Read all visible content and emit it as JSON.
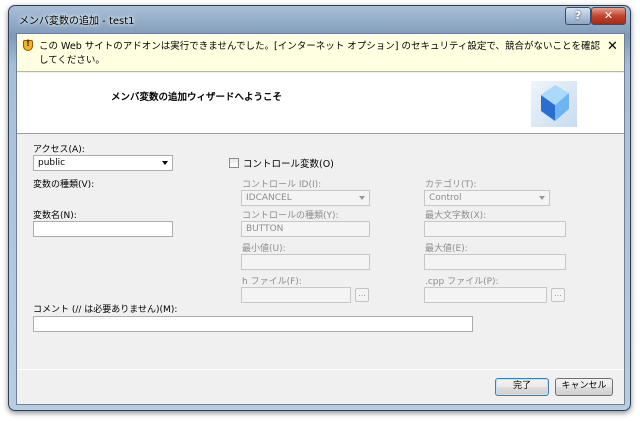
{
  "window": {
    "title": "メンバ変数の追加 - test1",
    "help_label": "?",
    "close_label": "✕"
  },
  "infobar": {
    "message": "この Web サイトのアドオンは実行できませんでした。[インターネット オプション] のセキュリティ設定で、競合がないことを確認してください。",
    "close_label": "✕"
  },
  "header": {
    "welcome": "メンバ変数の追加ウィザードへようこそ"
  },
  "form": {
    "access_label": "アクセス(A):",
    "access_value": "public",
    "control_var_label": "コントロール変数(O)",
    "var_type_label": "変数の種類(V):",
    "var_name_label": "変数名(N):",
    "var_name_value": "",
    "control_id_label": "コントロール ID(I):",
    "control_id_value": "IDCANCEL",
    "category_label": "カテゴリ(T):",
    "category_value": "Control",
    "control_type_label": "コントロールの種類(Y):",
    "control_type_value": "BUTTON",
    "max_chars_label": "最大文字数(X):",
    "min_value_label": "最小値(U):",
    "max_value_label": "最大値(E):",
    "h_file_label": "h ファイル(F):",
    "cpp_file_label": ".cpp ファイル(P):",
    "browse_label": "...",
    "comment_label": "コメント (// は必要ありません)(M):",
    "comment_value": ""
  },
  "buttons": {
    "finish": "完了",
    "cancel": "キャンセル"
  },
  "colors": {
    "infobar_bg": "#ffffe1",
    "dialog_bg": "#f0f0f0",
    "close_red": "#c4432b"
  }
}
